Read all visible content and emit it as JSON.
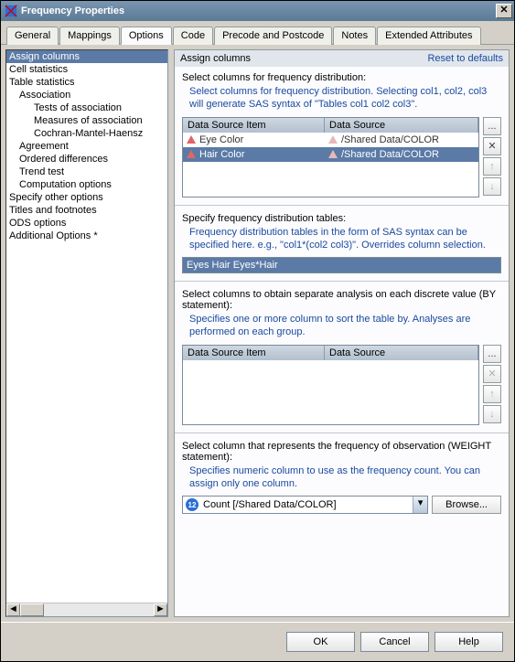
{
  "title": "Frequency Properties",
  "tabs": [
    "General",
    "Mappings",
    "Options",
    "Code",
    "Precode and Postcode",
    "Notes",
    "Extended Attributes"
  ],
  "active_tab": 2,
  "tree": [
    {
      "t": "Assign columns",
      "i": 0,
      "sel": true
    },
    {
      "t": "Cell statistics",
      "i": 0
    },
    {
      "t": "Table statistics",
      "i": 0
    },
    {
      "t": "Association",
      "i": 1
    },
    {
      "t": "Tests of association",
      "i": 2
    },
    {
      "t": "Measures of association",
      "i": 2
    },
    {
      "t": "Cochran-Mantel-Haensz",
      "i": 2
    },
    {
      "t": "Agreement",
      "i": 1
    },
    {
      "t": "Ordered differences",
      "i": 1
    },
    {
      "t": "Trend test",
      "i": 1
    },
    {
      "t": "Computation options",
      "i": 1
    },
    {
      "t": "Specify other options",
      "i": 0
    },
    {
      "t": "Titles and footnotes",
      "i": 0
    },
    {
      "t": "ODS options",
      "i": 0
    },
    {
      "t": "Additional Options *",
      "i": 0
    }
  ],
  "panel": {
    "heading": "Assign columns",
    "reset": "Reset to defaults",
    "s1_label": "Select columns for frequency distribution:",
    "s1_help": "Select columns for frequency distribution.  Selecting col1, col2, col3 will generate SAS syntax of \"Tables col1 col2 col3\".",
    "gridcols": {
      "c1": "Data Source Item",
      "c2": "Data Source"
    },
    "grid1": [
      {
        "item": "Eye Color",
        "src": "/Shared Data/COLOR",
        "sel": false
      },
      {
        "item": "Hair Color",
        "src": "/Shared Data/COLOR",
        "sel": true
      }
    ],
    "s2_label": "Specify frequency distribution tables:",
    "s2_help": "Frequency distribution tables in the form of SAS syntax can be specified here. e.g., \"col1*(col2 col3)\".  Overrides column selection.",
    "s2_value": "Eyes Hair Eyes*Hair",
    "s3_label": "Select columns to obtain separate analysis on each discrete value (BY statement):",
    "s3_help": "Specifies one or more column to sort the table by. Analyses are performed on each group.",
    "s4_label": "Select column that represents the frequency of observation (WEIGHT statement):",
    "s4_help": "Specifies numeric column to use as the frequency count. You can assign only one column.",
    "s4_value": "Count [/Shared Data/COLOR]",
    "browse": "Browse..."
  },
  "footer": {
    "ok": "OK",
    "cancel": "Cancel",
    "help": "Help"
  },
  "icons": {
    "ellipsis": "...",
    "x": "✕",
    "up": "↑",
    "down": "↓",
    "arrowL": "◄",
    "arrowR": "►",
    "arrowD": "▾"
  }
}
